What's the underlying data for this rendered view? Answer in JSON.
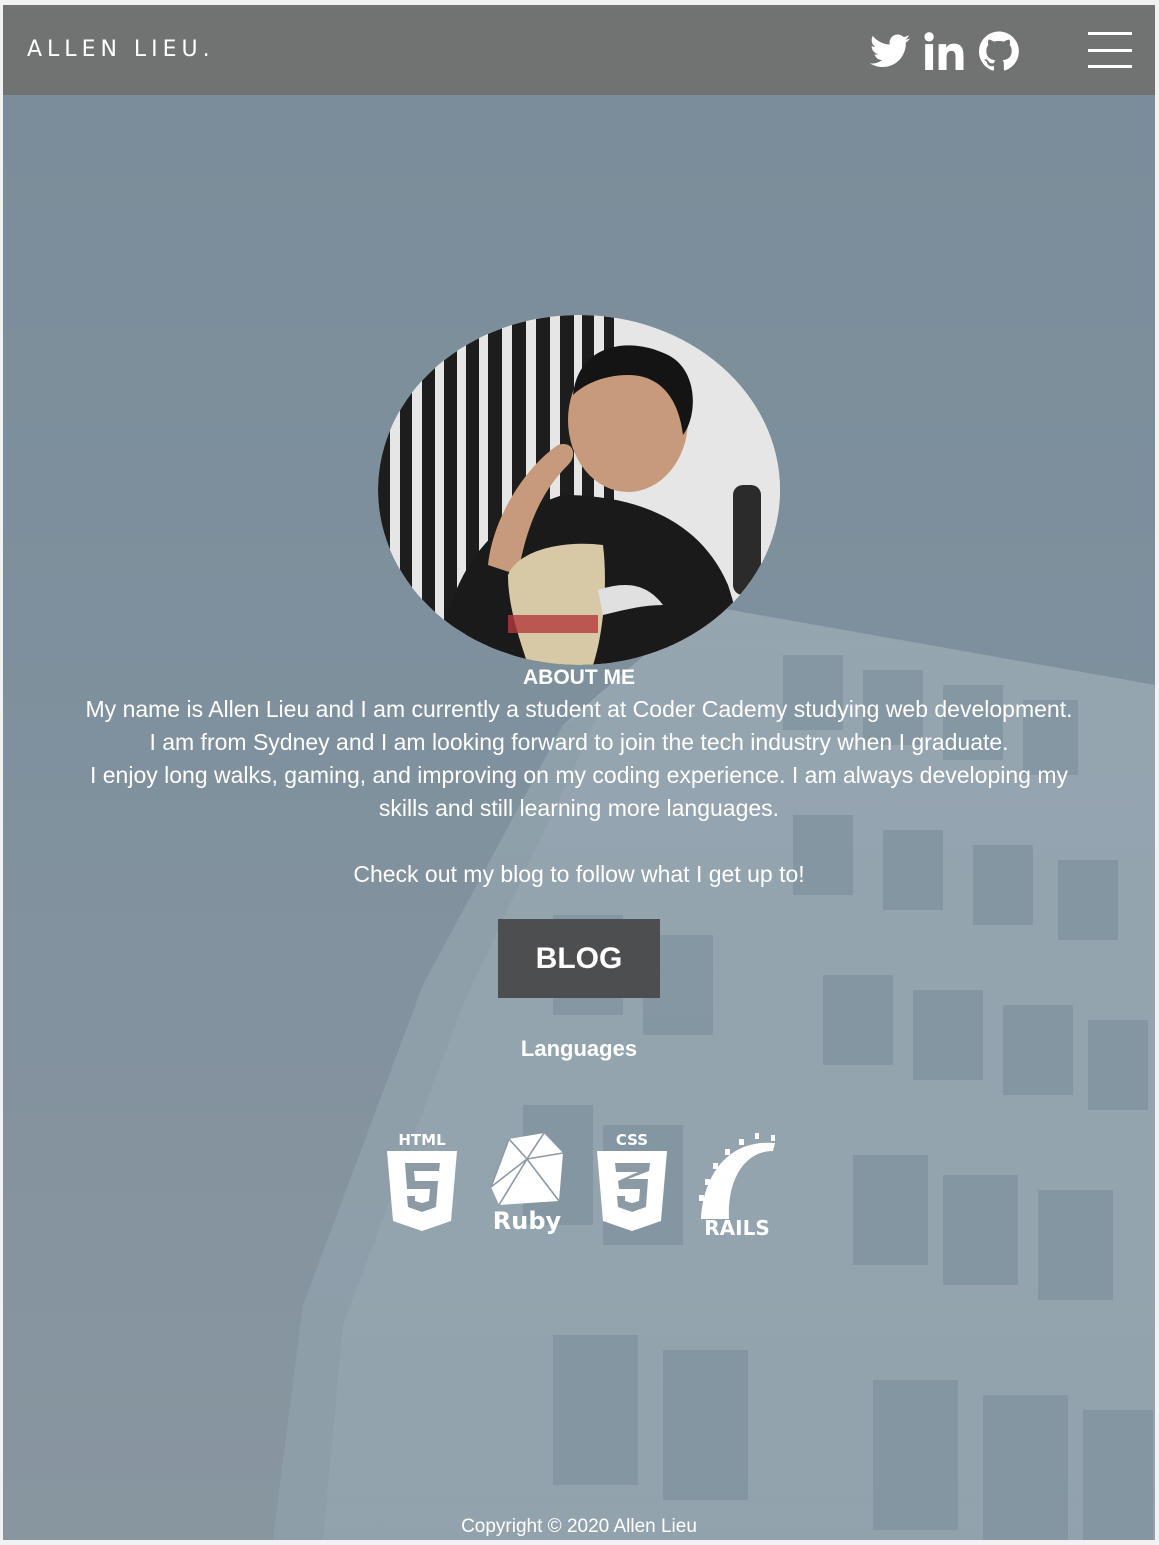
{
  "nav": {
    "brand": "ALLEN LIEU.",
    "social": [
      "twitter-icon",
      "linkedin-icon",
      "github-icon"
    ],
    "menu_icon": "hamburger-menu-icon"
  },
  "about": {
    "title": "ABOUT ME",
    "line1": "My name is Allen Lieu and I am currently a student at Coder Cademy studying web development.",
    "line2": "I am from Sydney and I am looking forward to join the tech industry when I graduate.",
    "line3": "I enjoy long walks, gaming, and improving on my coding experience. I am always developing my skills and still learning more languages.",
    "blog_cta": "Check out my blog to follow what I get up to!",
    "blog_button": "BLOG"
  },
  "languages": {
    "title": "Languages",
    "items": [
      {
        "icon": "html5-icon",
        "label": "HTML"
      },
      {
        "icon": "ruby-icon",
        "label": "Ruby"
      },
      {
        "icon": "css3-icon",
        "label": "CSS"
      },
      {
        "icon": "rails-icon",
        "label": "RAILS"
      }
    ]
  },
  "footer": {
    "copyright": "Copyright © 2020 Allen Lieu"
  },
  "colors": {
    "navbar": "#717373",
    "button": "#4d4e50",
    "text": "#ffffff"
  }
}
